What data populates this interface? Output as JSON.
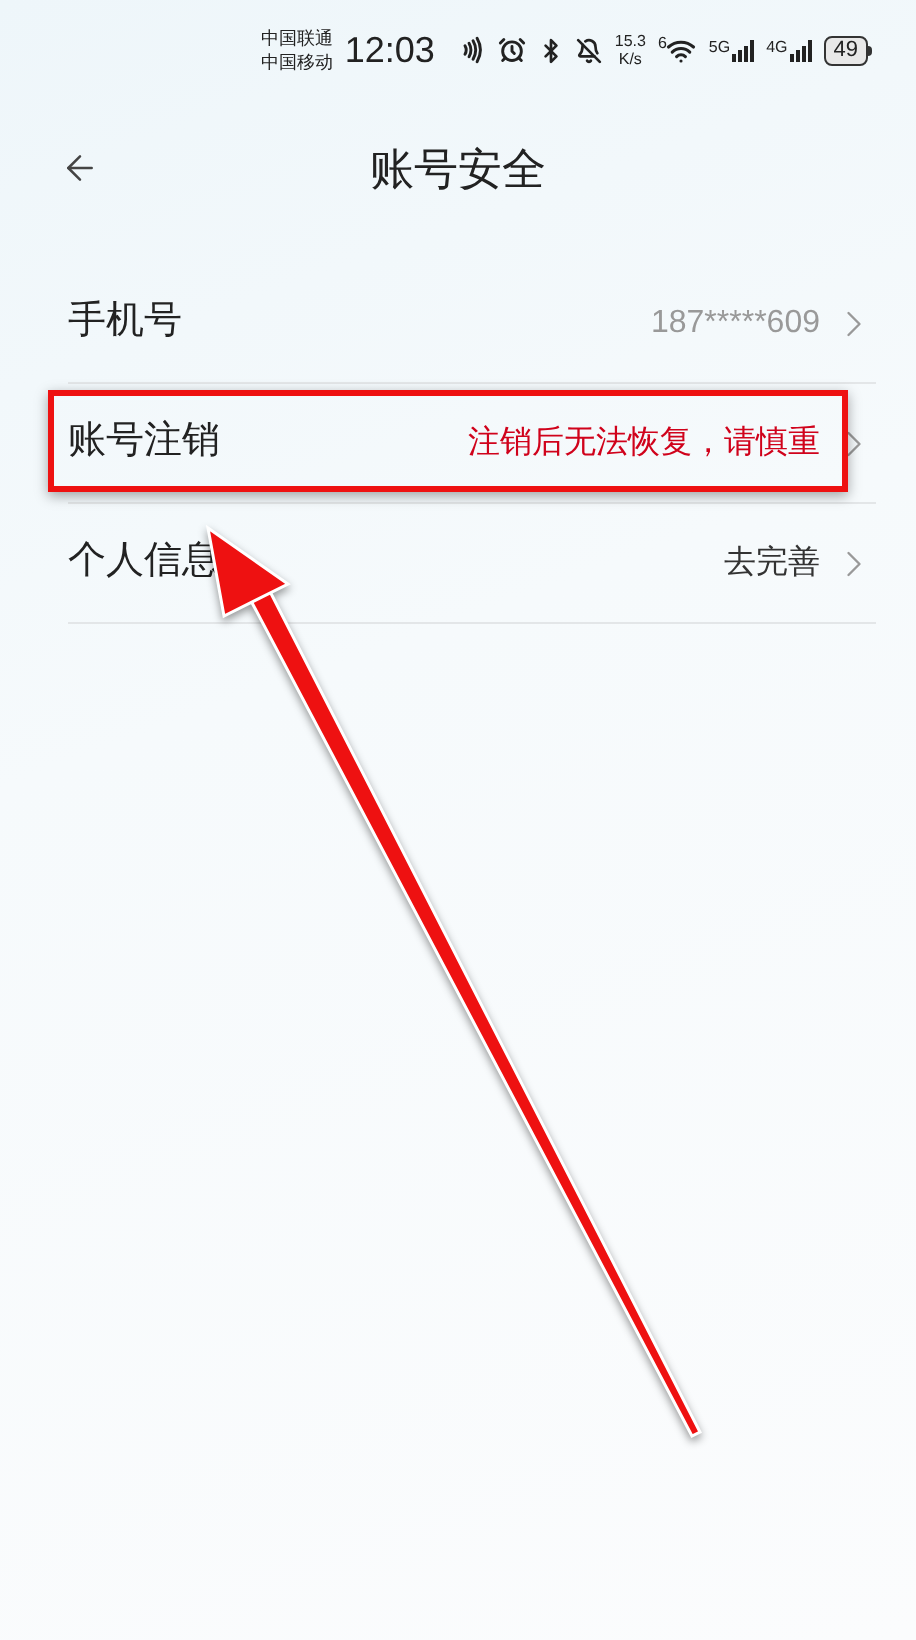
{
  "status_bar": {
    "carriers": [
      "中国联通",
      "中国移动"
    ],
    "time": "12:03",
    "speed_value": "15.3",
    "speed_unit": "K/s",
    "wifi_badge": "6",
    "signal_1_label": "5G",
    "signal_2_label": "4G",
    "battery": "49"
  },
  "header": {
    "title": "账号安全"
  },
  "rows": [
    {
      "label": "手机号",
      "value": "187*****609",
      "color": "#999999",
      "highlighted": false
    },
    {
      "label": "账号注销",
      "value": "注销后无法恢复，请慎重",
      "color": "#d0021b",
      "highlighted": true
    },
    {
      "label": "个人信息",
      "value": "去完善",
      "color": "#333333",
      "highlighted": false
    }
  ]
}
